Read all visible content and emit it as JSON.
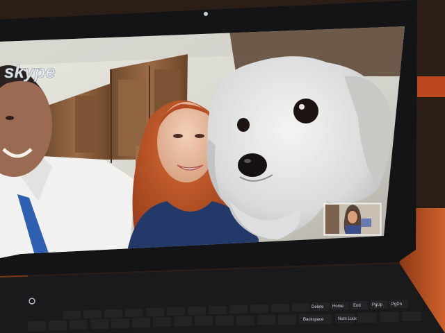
{
  "video_call": {
    "app_logo": "skype",
    "participants_main": [
      "man-in-white-shirt",
      "red-haired-woman",
      "white-dog"
    ],
    "self_preview_participant": "woman-with-dark-hair"
  },
  "keyboard": {
    "row_top_labels": [
      "Delete",
      "Home",
      "End",
      "PgUp",
      "PgDn"
    ],
    "row_mid_labels": [
      "Backspace",
      "Num Lock"
    ]
  },
  "colors": {
    "skype_logo": "#dfe6ee",
    "bezel": "#121214",
    "wall": "#d9d9d2",
    "cabinet": "#8a5f3e",
    "dog_fur": "#e4e4e4",
    "woman_hair": "#c0552a",
    "desk": "#c4561f"
  }
}
